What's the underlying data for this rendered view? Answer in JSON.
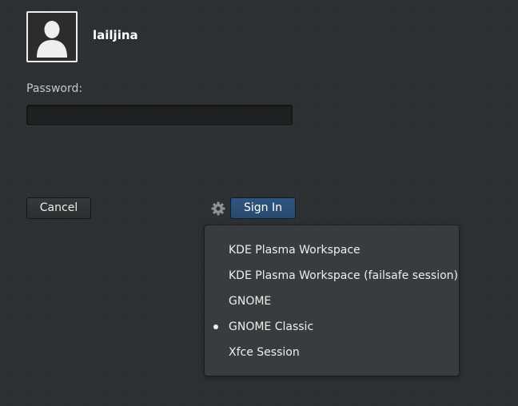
{
  "user": {
    "name": "lailjina",
    "avatar_icon": "user-silhouette-icon"
  },
  "password": {
    "label": "Password:",
    "value": "",
    "placeholder": ""
  },
  "buttons": {
    "cancel_label": "Cancel",
    "sign_in_label": "Sign In"
  },
  "session_selector": {
    "icon": "gear-icon",
    "selected": "GNOME Classic",
    "items": [
      {
        "label": "KDE Plasma Workspace",
        "selected": false
      },
      {
        "label": "KDE Plasma Workspace (failsafe session)",
        "selected": false
      },
      {
        "label": "GNOME",
        "selected": false
      },
      {
        "label": "GNOME Classic",
        "selected": true
      },
      {
        "label": "Xfce Session",
        "selected": false
      }
    ]
  },
  "colors": {
    "background": "#2c2f31",
    "sign_in_button": "#2b4d73",
    "menu_background": "#393c3e",
    "text": "#eeeeec"
  }
}
